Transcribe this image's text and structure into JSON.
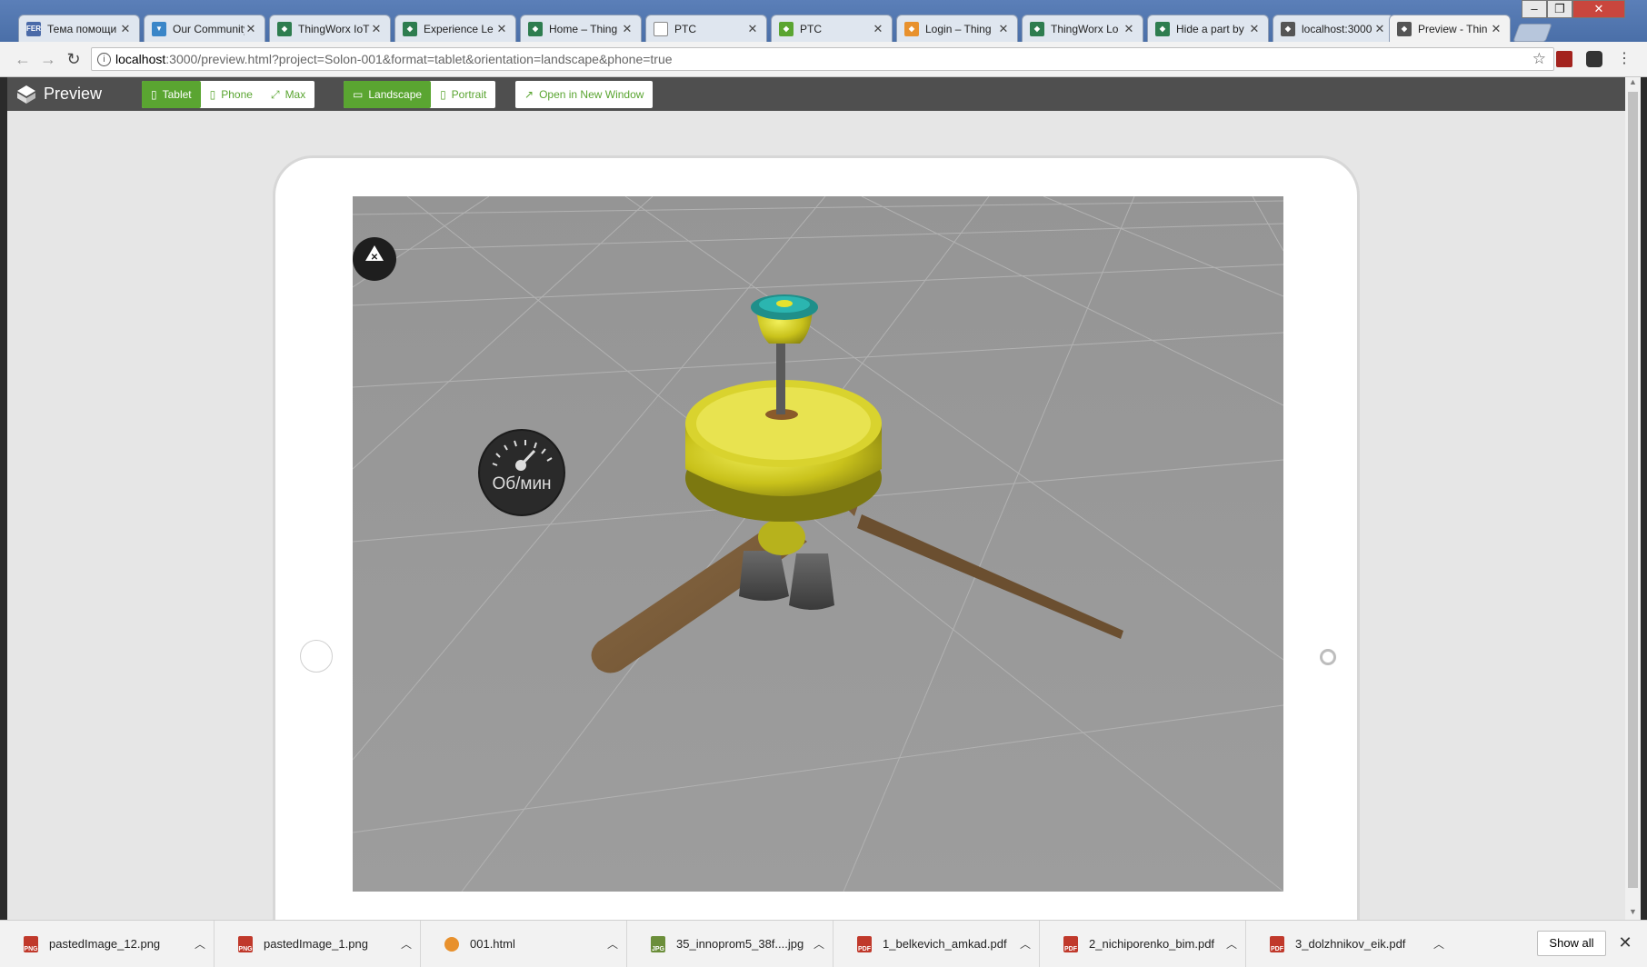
{
  "browser": {
    "tabs": [
      {
        "label": "Тема помощи",
        "icon": "fer-icon",
        "color": "#4a6aa8",
        "close": "✕"
      },
      {
        "label": "Our Community",
        "icon": "community-icon",
        "color": "#3a86c8",
        "close": "✕"
      },
      {
        "label": "ThingWorx IoT",
        "icon": "thingworx-icon",
        "color": "#2e7d4f",
        "close": "✕"
      },
      {
        "label": "Experience Le",
        "icon": "thingworx-icon",
        "color": "#2e7d4f",
        "close": "✕"
      },
      {
        "label": "Home – Thing",
        "icon": "thingworx-icon",
        "color": "#2e7d4f",
        "close": "✕"
      },
      {
        "label": "PTC",
        "icon": "page-icon",
        "color": "#ffffff",
        "close": "✕"
      },
      {
        "label": "PTC",
        "icon": "thingworx-icon",
        "color": "#5aa531",
        "close": "✕"
      },
      {
        "label": "Login – Thing",
        "icon": "login-icon",
        "color": "#e8912d",
        "close": "✕"
      },
      {
        "label": "ThingWorx Lo",
        "icon": "thingworx-icon",
        "color": "#2e7d4f",
        "close": "✕"
      },
      {
        "label": "Hide a part by",
        "icon": "thingworx-icon",
        "color": "#2e7d4f",
        "close": "✕"
      },
      {
        "label": "localhost:3000",
        "icon": "thingworx-icon",
        "color": "#555555",
        "close": "✕"
      },
      {
        "label": "Preview - Thin",
        "icon": "thingworx-icon",
        "color": "#555555",
        "close": "✕",
        "active": true
      }
    ],
    "address": {
      "host": "localhost",
      "rest": ":3000/preview.html?project=Solon-001&format=tablet&orientation=landscape&phone=true"
    }
  },
  "preview": {
    "title": "Preview",
    "device_buttons": [
      "Tablet",
      "Phone",
      "Max"
    ],
    "orientation_buttons": [
      "Landscape",
      "Portrait"
    ],
    "open_new_window": "Open in New Window",
    "accent": "#5aa531"
  },
  "viewport": {
    "gauge_label": "Об/мин",
    "model": "ceiling-fan"
  },
  "downloads": {
    "items": [
      {
        "name": "pastedImage_12.png",
        "icon": "png-file-icon",
        "color": "#c0392b"
      },
      {
        "name": "pastedImage_1.png",
        "icon": "png-file-icon",
        "color": "#c0392b"
      },
      {
        "name": "001.html",
        "icon": "chrome-icon",
        "color": "#e8912d"
      },
      {
        "name": "35_innoprom5_38f....jpg",
        "icon": "jpg-file-icon",
        "color": "#6b8e3a"
      },
      {
        "name": "1_belkevich_amkad.pdf",
        "icon": "pdf-file-icon",
        "color": "#c0392b"
      },
      {
        "name": "2_nichiporenko_bim.pdf",
        "icon": "pdf-file-icon",
        "color": "#c0392b"
      },
      {
        "name": "3_dolzhnikov_eik.pdf",
        "icon": "pdf-file-icon",
        "color": "#c0392b"
      }
    ],
    "show_all": "Show all",
    "close": "✕"
  }
}
